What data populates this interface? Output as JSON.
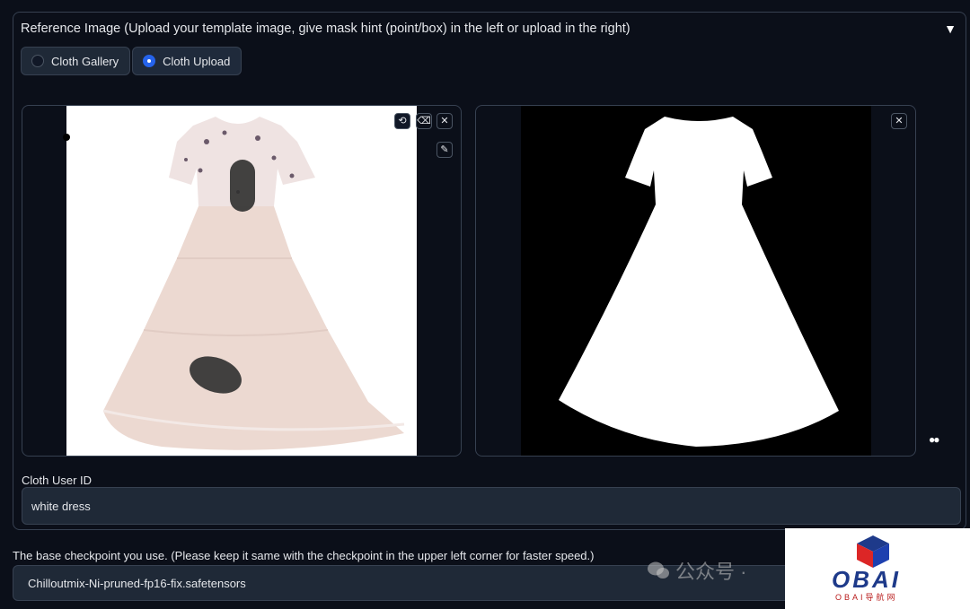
{
  "reference": {
    "title": "Reference Image (Upload your template image, give mask hint (point/box) in the left or upload in the right)",
    "toggle_icon": "▼",
    "options": [
      {
        "label": "Cloth Gallery",
        "selected": false
      },
      {
        "label": "Cloth Upload",
        "selected": true
      }
    ]
  },
  "left_image": {
    "tools": {
      "undo": "⟲",
      "eraser": "⌫",
      "close": "✕",
      "brush": "✎"
    }
  },
  "right_image": {
    "tools": {
      "close": "✕"
    }
  },
  "cloth_user_id": {
    "label": "Cloth User ID",
    "value": "white dress"
  },
  "checkpoint": {
    "label": "The base checkpoint you use. (Please keep it same with the checkpoint in the upper left corner for faster speed.)",
    "value": "Chilloutmix-Ni-pruned-fp16-fix.safetensors"
  },
  "watermark": {
    "text": "公众号 ·"
  },
  "logo": {
    "text": "OBAI",
    "subtext": "OBAI导航网"
  },
  "colors": {
    "background": "#0b0f19",
    "panel": "#1f2937",
    "border": "#374151",
    "accent": "#2563eb"
  }
}
